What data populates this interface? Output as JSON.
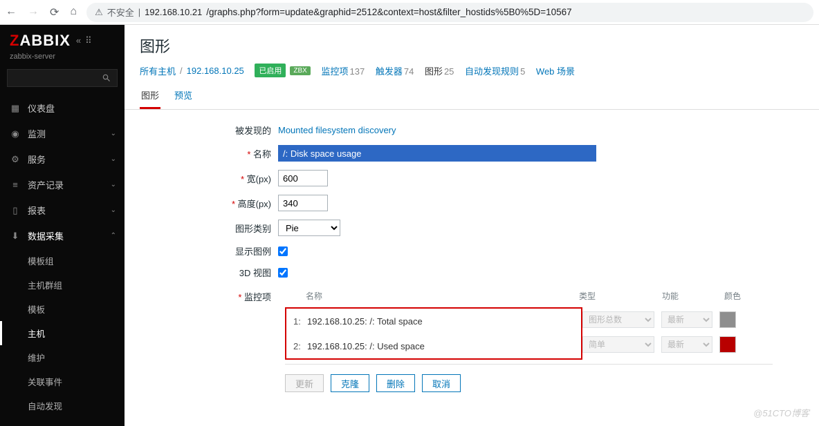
{
  "browser": {
    "insecure": "不安全",
    "host": "192.168.10.21",
    "path": "/graphs.php?form=update&graphid=2512&context=host&filter_hostids%5B0%5D=10567"
  },
  "sidebar": {
    "logo_z": "Z",
    "logo_rest": "ABBIX",
    "server": "zabbix-server",
    "items": [
      {
        "label": "仪表盘"
      },
      {
        "label": "监测"
      },
      {
        "label": "服务"
      },
      {
        "label": "资产记录"
      },
      {
        "label": "报表"
      },
      {
        "label": "数据采集"
      }
    ],
    "sub": [
      {
        "label": "模板组"
      },
      {
        "label": "主机群组"
      },
      {
        "label": "模板"
      },
      {
        "label": "主机"
      },
      {
        "label": "维护"
      },
      {
        "label": "关联事件"
      },
      {
        "label": "自动发现"
      }
    ]
  },
  "page": {
    "title": "图形",
    "breadcrumb": {
      "all_hosts": "所有主机",
      "host_ip": "192.168.10.25",
      "enabled": "已启用",
      "zbx": "ZBX",
      "monitors": "监控项",
      "monitors_n": "137",
      "triggers": "触发器",
      "triggers_n": "74",
      "graphs": "图形",
      "graphs_n": "25",
      "discovery": "自动发现规则",
      "discovery_n": "5",
      "web": "Web 场景"
    },
    "tabs": {
      "graph": "图形",
      "preview": "预览"
    }
  },
  "form": {
    "discovered_label": "被发现的",
    "discovered_link": "Mounted filesystem discovery",
    "name_label": "名称",
    "name_value": "/: Disk space usage",
    "width_label": "宽(px)",
    "width_value": "600",
    "height_label": "高度(px)",
    "height_value": "340",
    "type_label": "图形类别",
    "type_value": "Pie",
    "legend_label": "显示图例",
    "view3d_label": "3D 视图",
    "items_label": "监控项",
    "grid": {
      "h_name": "名称",
      "h_type": "类型",
      "h_fn": "功能",
      "h_color": "颜色",
      "rows": [
        {
          "idx": "1:",
          "name": "192.168.10.25: /: Total space",
          "type": "图形总数",
          "fn": "最新",
          "color": "grey"
        },
        {
          "idx": "2:",
          "name": "192.168.10.25: /: Used space",
          "type": "简单",
          "fn": "最新",
          "color": "red"
        }
      ]
    },
    "buttons": {
      "update": "更新",
      "clone": "克隆",
      "delete": "删除",
      "cancel": "取消"
    }
  },
  "watermark": "@51CTO博客"
}
